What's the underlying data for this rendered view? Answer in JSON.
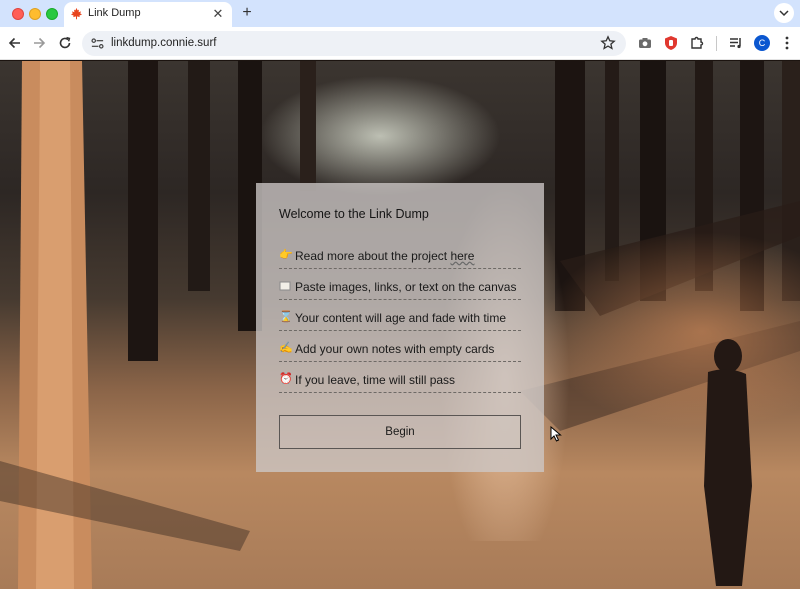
{
  "browser": {
    "tab_title": "Link Dump",
    "tab_favicon": "maple-leaf-icon",
    "url": "linkdump.connie.surf",
    "profile_initial": "C"
  },
  "welcome": {
    "title": "Welcome to the Link Dump",
    "items": [
      {
        "icon": "pointing-hand-icon",
        "text": "Read more about the project ",
        "link": "here"
      },
      {
        "icon": "frame-icon",
        "text": "Paste images, links, or text on the canvas"
      },
      {
        "icon": "hourglass-icon",
        "text": "Your content will age and fade with time"
      },
      {
        "icon": "writing-hand-icon",
        "text": "Add your own notes with empty cards"
      },
      {
        "icon": "alarm-clock-icon",
        "text": "If you leave, time will still pass"
      }
    ],
    "button_label": "Begin"
  },
  "colors": {
    "tabstrip": "#d3e3fd",
    "omnibox": "#eef1f6",
    "card": "#cdc8c6"
  }
}
